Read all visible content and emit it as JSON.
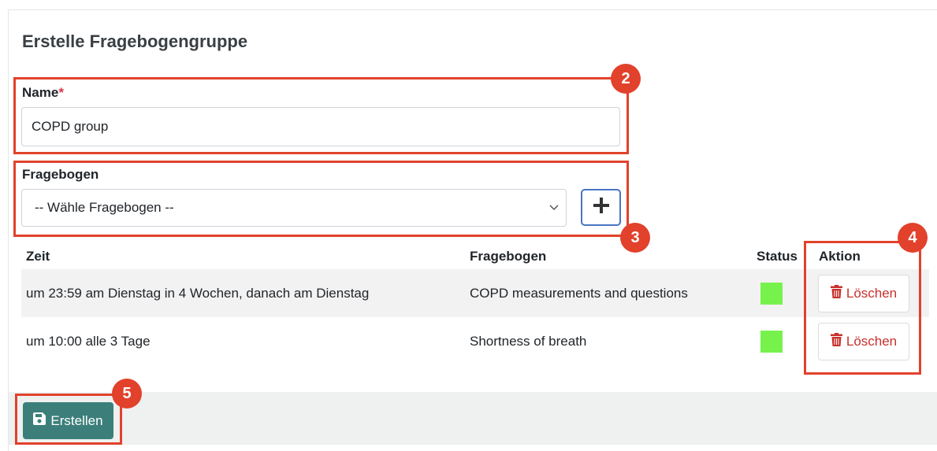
{
  "form": {
    "title": "Erstelle Fragebogengruppe",
    "name_label": "Name",
    "name_required_mark": "*",
    "name_value": "COPD group",
    "questionnaire_label": "Fragebogen",
    "questionnaire_select_value": "-- Wähle Fragebogen --",
    "add_button_icon": "plus-icon"
  },
  "table": {
    "headers": {
      "time": "Zeit",
      "questionnaire": "Fragebogen",
      "status": "Status",
      "action": "Aktion"
    },
    "rows": [
      {
        "time": "um 23:59 am Dienstag in 4 Wochen, danach am Dienstag",
        "questionnaire": "COPD measurements and questions",
        "status_color": "#77f24c",
        "delete_label": "Löschen"
      },
      {
        "time": "um 10:00 alle 3 Tage",
        "questionnaire": "Shortness of breath",
        "status_color": "#77f24c",
        "delete_label": "Löschen"
      }
    ]
  },
  "footer": {
    "submit_label": "Erstellen",
    "submit_icon": "save-icon"
  },
  "annotations": {
    "color": "#e2412b",
    "badges": [
      "2",
      "3",
      "4",
      "5"
    ]
  },
  "colors": {
    "primary": "#3c7f7a",
    "danger": "#c9302c",
    "status_ok": "#77f24c",
    "focus_border": "#4a75c4"
  }
}
